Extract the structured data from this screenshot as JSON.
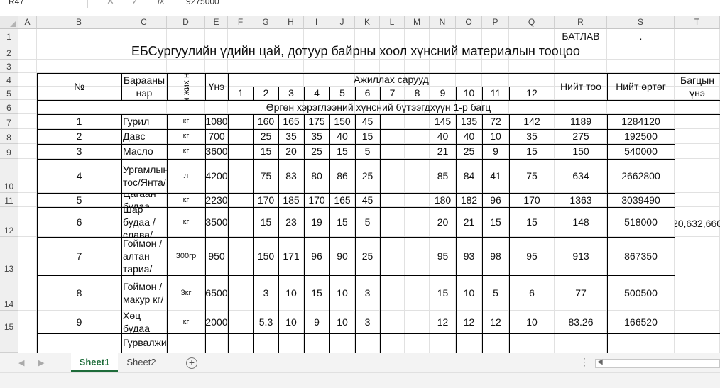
{
  "formula_bar": {
    "name_box": "R47",
    "fx": "fx",
    "value": "9275000"
  },
  "columns": [
    "A",
    "B",
    "C",
    "D",
    "E",
    "F",
    "G",
    "H",
    "I",
    "J",
    "K",
    "L",
    "M",
    "N",
    "O",
    "P",
    "Q",
    "R",
    "S",
    "T"
  ],
  "rows": [
    "1",
    "2",
    "3",
    "4",
    "5",
    "6",
    "7",
    "8",
    "9",
    "10",
    "11",
    "12",
    "13",
    "14",
    "15"
  ],
  "sheet": {
    "approve": "БАТЛАВ",
    "dot": ".",
    "title": "ЕБСургуулийн үдийн цай, дотуур байрны хоол хүнсний материалын тооцоо",
    "headers": {
      "no": "№",
      "name": "Барааны нэр",
      "unit": "Хэм жих нэгж",
      "price": "Үнэ",
      "days_group": "Ажиллах сарууд",
      "months": [
        "1",
        "2",
        "3",
        "4",
        "5",
        "6",
        "7",
        "8",
        "9",
        "10",
        "11",
        "12"
      ],
      "total_qty": "Нийт тоо",
      "total_cost": "Нийт өртөг",
      "package_price": "Багцын үнэ"
    },
    "section": "Өргөн хэрэглээний хүнсний бүтээгдхүүн 1-р багц",
    "items": [
      {
        "no": "1",
        "name": "Гурил",
        "unit": "кг",
        "price": "1080",
        "m": [
          "",
          "160",
          "165",
          "175",
          "150",
          "45",
          "",
          "",
          "145",
          "135",
          "72",
          "142"
        ],
        "qty": "1189",
        "cost": "1284120"
      },
      {
        "no": "2",
        "name": "Давс",
        "unit": "кг",
        "price": "700",
        "m": [
          "",
          "25",
          "35",
          "35",
          "40",
          "15",
          "",
          "",
          "40",
          "40",
          "10",
          "35"
        ],
        "qty": "275",
        "cost": "192500"
      },
      {
        "no": "3",
        "name": "Масло",
        "unit": "кг",
        "price": "3600",
        "m": [
          "",
          "15",
          "20",
          "25",
          "15",
          "5",
          "",
          "",
          "21",
          "25",
          "9",
          "15"
        ],
        "qty": "150",
        "cost": "540000"
      },
      {
        "no": "4",
        "name": "Ургамлын тос/Янта/",
        "unit": "л",
        "price": "4200",
        "m": [
          "",
          "75",
          "83",
          "80",
          "86",
          "25",
          "",
          "",
          "85",
          "84",
          "41",
          "75"
        ],
        "qty": "634",
        "cost": "2662800"
      },
      {
        "no": "5",
        "name": "Цагаан будаа",
        "unit": "кг",
        "price": "2230",
        "m": [
          "",
          "170",
          "185",
          "170",
          "165",
          "45",
          "",
          "",
          "180",
          "182",
          "96",
          "170"
        ],
        "qty": "1363",
        "cost": "3039490"
      },
      {
        "no": "6",
        "name": "Шар будаа /слава/",
        "unit": "кг",
        "price": "3500",
        "m": [
          "",
          "15",
          "23",
          "19",
          "15",
          "5",
          "",
          "",
          "20",
          "21",
          "15",
          "15"
        ],
        "qty": "148",
        "cost": "518000"
      },
      {
        "no": "7",
        "name": "Гоймон /алтан тариа/",
        "unit": "300гр",
        "price": "950",
        "m": [
          "",
          "150",
          "171",
          "96",
          "90",
          "25",
          "",
          "",
          "95",
          "93",
          "98",
          "95"
        ],
        "qty": "913",
        "cost": "867350"
      },
      {
        "no": "8",
        "name": "Гоймон /макур кг/",
        "unit": "3кг",
        "price": "6500",
        "m": [
          "",
          "3",
          "10",
          "15",
          "10",
          "3",
          "",
          "",
          "15",
          "10",
          "5",
          "6"
        ],
        "qty": "77",
        "cost": "500500"
      },
      {
        "no": "9",
        "name": "Хөц будаа",
        "unit": "кг",
        "price": "2000",
        "m": [
          "",
          "5.3",
          "10",
          "9",
          "10",
          "3",
          "",
          "",
          "12",
          "12",
          "12",
          "10"
        ],
        "qty": "83.26",
        "cost": "166520"
      }
    ],
    "partial_name": "Гурвалжин",
    "package_total": "20,632,660"
  },
  "tabs": [
    "Sheet1",
    "Sheet2"
  ]
}
